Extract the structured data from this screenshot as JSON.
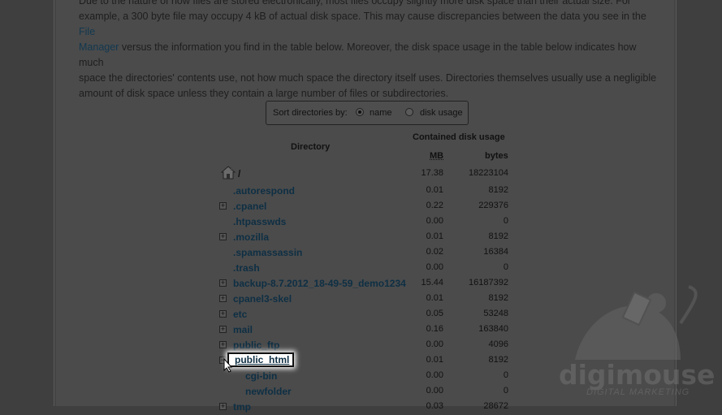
{
  "intro": {
    "line1": "Due to the nature of how files are stored electronically, most files occupy slightly more disk space than their actual size. For",
    "line2": "example, a 300 byte file may occupy 4 kB of actual disk space. This may cause discrepancies between the data you see in the",
    "link_file": "File",
    "link_manager": "Manager",
    "line3": "versus the information you find in the table below. Moreover, the disk space usage in the table below indicates how much",
    "line4": "space the directories' contents use, not how much space the directory itself uses. Directories themselves usually use a negligible",
    "line5": "amount of disk space unless they contain a large number of files or subdirectories."
  },
  "sort": {
    "label": "Sort directories by:",
    "option_name": "name",
    "option_disk": "disk usage",
    "selected": "name"
  },
  "table": {
    "col_directory": "Directory",
    "col_contained": "Contained disk usage",
    "col_mb": "MB",
    "col_bytes": "bytes",
    "root": {
      "mb": "17.38",
      "bytes": "18223104"
    },
    "rows": [
      {
        "name": ".autorespond",
        "mb": "0.01",
        "bytes": "8192",
        "expandable": false
      },
      {
        "name": ".cpanel",
        "mb": "0.22",
        "bytes": "229376",
        "expandable": true
      },
      {
        "name": ".htpasswds",
        "mb": "0.00",
        "bytes": "0",
        "expandable": false
      },
      {
        "name": ".mozilla",
        "mb": "0.01",
        "bytes": "8192",
        "expandable": true
      },
      {
        "name": ".spamassassin",
        "mb": "0.02",
        "bytes": "16384",
        "expandable": false
      },
      {
        "name": ".trash",
        "mb": "0.00",
        "bytes": "0",
        "expandable": false
      },
      {
        "name": "backup-8.7.2012_18-49-59_demo1234",
        "mb": "15.44",
        "bytes": "16187392",
        "expandable": true
      },
      {
        "name": "cpanel3-skel",
        "mb": "0.01",
        "bytes": "8192",
        "expandable": true
      },
      {
        "name": "etc",
        "mb": "0.05",
        "bytes": "53248",
        "expandable": true
      },
      {
        "name": "mail",
        "mb": "0.16",
        "bytes": "163840",
        "expandable": true
      },
      {
        "name": "public_ftp",
        "mb": "0.00",
        "bytes": "4096",
        "expandable": true
      },
      {
        "name": "public_html",
        "mb": "0.01",
        "bytes": "8192",
        "expandable": true
      },
      {
        "name": "cgi-bin",
        "mb": "0.00",
        "bytes": "0",
        "expandable": false
      },
      {
        "name": "newfolder",
        "mb": "0.00",
        "bytes": "0",
        "expandable": false
      },
      {
        "name": "tmp",
        "mb": "0.03",
        "bytes": "28672",
        "expandable": true
      }
    ]
  },
  "logo": {
    "text": "digimouse",
    "subtext": "DIGITAL MARKETING"
  },
  "icons": {
    "root": "home-folder-icon",
    "expand": "plus-box-icon",
    "cursor": "pointer-cursor-icon"
  }
}
